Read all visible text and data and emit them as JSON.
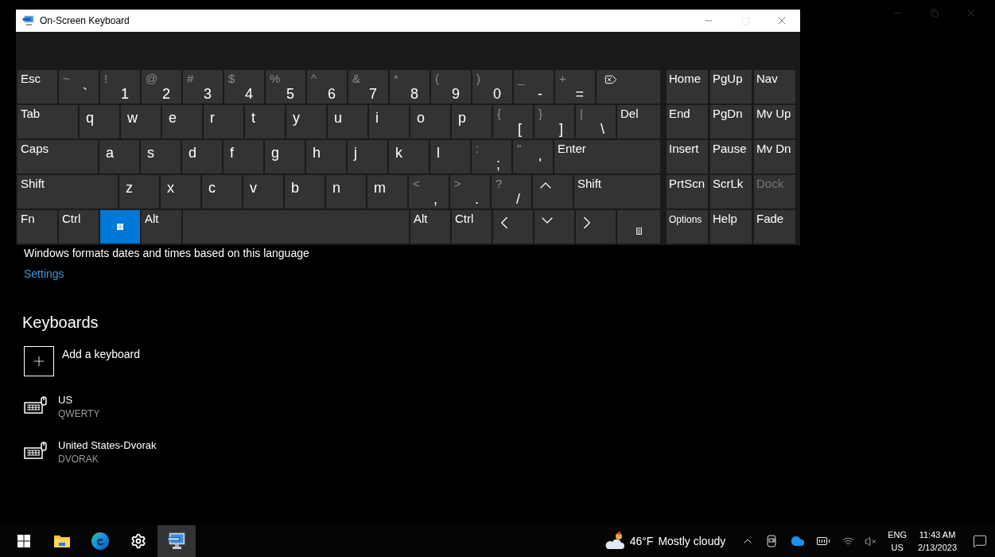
{
  "osk": {
    "title": "On-Screen Keyboard",
    "title_buttons": [
      {
        "kind": "minimize",
        "disabled": false
      },
      {
        "kind": "maximize",
        "disabled": true
      },
      {
        "kind": "close",
        "disabled": false
      }
    ],
    "keyboard_rows": [
      {
        "keys": [
          {
            "kind": "text",
            "label": "Esc",
            "pressed": false
          },
          {
            "kind": "dual",
            "shift": "~",
            "label": "`",
            "pressed": false
          },
          {
            "kind": "dual",
            "shift": "!",
            "label": "1",
            "pressed": false
          },
          {
            "kind": "dual",
            "shift": "@",
            "label": "2",
            "pressed": false
          },
          {
            "kind": "dual",
            "shift": "#",
            "label": "3",
            "pressed": false
          },
          {
            "kind": "dual",
            "shift": "$",
            "label": "4",
            "pressed": false
          },
          {
            "kind": "dual",
            "shift": "%",
            "label": "5",
            "pressed": false
          },
          {
            "kind": "dual",
            "shift": "^",
            "label": "6",
            "pressed": false
          },
          {
            "kind": "dual",
            "shift": "&",
            "label": "7",
            "pressed": false
          },
          {
            "kind": "dual",
            "shift": "*",
            "label": "8",
            "pressed": false
          },
          {
            "kind": "dual",
            "shift": "(",
            "label": "9",
            "pressed": false
          },
          {
            "kind": "dual",
            "shift": ")",
            "label": "0",
            "pressed": false
          },
          {
            "kind": "dual",
            "shift": "_",
            "label": "-",
            "pressed": false
          },
          {
            "kind": "dual",
            "shift": "+",
            "label": "=",
            "pressed": false
          },
          {
            "kind": "backspace",
            "pressed": false
          }
        ]
      },
      {
        "keys": [
          {
            "kind": "text",
            "label": "Tab",
            "pressed": false
          },
          {
            "kind": "letter",
            "label": "q",
            "pressed": false
          },
          {
            "kind": "letter",
            "label": "w",
            "pressed": false
          },
          {
            "kind": "letter",
            "label": "e",
            "pressed": false
          },
          {
            "kind": "letter",
            "label": "r",
            "pressed": false
          },
          {
            "kind": "letter",
            "label": "t",
            "pressed": false
          },
          {
            "kind": "letter",
            "label": "y",
            "pressed": false
          },
          {
            "kind": "letter",
            "label": "u",
            "pressed": false
          },
          {
            "kind": "letter",
            "label": "i",
            "pressed": false
          },
          {
            "kind": "letter",
            "label": "o",
            "pressed": false
          },
          {
            "kind": "letter",
            "label": "p",
            "pressed": false
          },
          {
            "kind": "dual",
            "shift": "{",
            "label": "[",
            "pressed": false
          },
          {
            "kind": "dual",
            "shift": "}",
            "label": "]",
            "pressed": false
          },
          {
            "kind": "dual",
            "shift": "|",
            "label": "\\",
            "pressed": false
          },
          {
            "kind": "text",
            "label": "Del",
            "pressed": false
          }
        ]
      },
      {
        "keys": [
          {
            "kind": "text",
            "label": "Caps",
            "pressed": false
          },
          {
            "kind": "letter",
            "label": "a",
            "pressed": false
          },
          {
            "kind": "letter",
            "label": "s",
            "pressed": false
          },
          {
            "kind": "letter",
            "label": "d",
            "pressed": false
          },
          {
            "kind": "letter",
            "label": "f",
            "pressed": false
          },
          {
            "kind": "letter",
            "label": "g",
            "pressed": false
          },
          {
            "kind": "letter",
            "label": "h",
            "pressed": false
          },
          {
            "kind": "letter",
            "label": "j",
            "pressed": false
          },
          {
            "kind": "letter",
            "label": "k",
            "pressed": false
          },
          {
            "kind": "letter",
            "label": "l",
            "pressed": false
          },
          {
            "kind": "dual",
            "shift": ":",
            "label": ";",
            "pressed": false
          },
          {
            "kind": "dual",
            "shift": "\"",
            "label": "'",
            "pressed": false
          },
          {
            "kind": "text",
            "label": "Enter",
            "pressed": false
          }
        ]
      },
      {
        "keys": [
          {
            "kind": "text",
            "label": "Shift",
            "pressed": false
          },
          {
            "kind": "letter",
            "label": "z",
            "pressed": false
          },
          {
            "kind": "letter",
            "label": "x",
            "pressed": false
          },
          {
            "kind": "letter",
            "label": "c",
            "pressed": false
          },
          {
            "kind": "letter",
            "label": "v",
            "pressed": false
          },
          {
            "kind": "letter",
            "label": "b",
            "pressed": false
          },
          {
            "kind": "letter",
            "label": "n",
            "pressed": false
          },
          {
            "kind": "letter",
            "label": "m",
            "pressed": false
          },
          {
            "kind": "dual",
            "shift": "<",
            "label": ",",
            "pressed": false
          },
          {
            "kind": "dual",
            "shift": ">",
            "label": ".",
            "pressed": false
          },
          {
            "kind": "dual",
            "shift": "?",
            "label": "/",
            "pressed": false
          },
          {
            "kind": "up",
            "pressed": false
          },
          {
            "kind": "text",
            "label": "Shift",
            "pressed": false
          }
        ]
      },
      {
        "keys": [
          {
            "kind": "text",
            "label": "Fn",
            "pressed": false
          },
          {
            "kind": "text",
            "label": "Ctrl",
            "pressed": false
          },
          {
            "kind": "win",
            "pressed": true
          },
          {
            "kind": "text",
            "label": "Alt",
            "pressed": false
          },
          {
            "kind": "space",
            "pressed": false
          },
          {
            "kind": "text",
            "label": "Alt",
            "pressed": false
          },
          {
            "kind": "text",
            "label": "Ctrl",
            "pressed": false
          },
          {
            "kind": "left",
            "pressed": false
          },
          {
            "kind": "down",
            "pressed": false
          },
          {
            "kind": "right",
            "pressed": false
          },
          {
            "kind": "menu",
            "pressed": false
          }
        ]
      }
    ],
    "nav_rows": [
      {
        "keys": [
          {
            "kind": "text",
            "label": "Home",
            "disabled": false
          },
          {
            "kind": "text",
            "label": "PgUp",
            "disabled": false
          },
          {
            "kind": "text",
            "label": "Nav",
            "disabled": false
          }
        ]
      },
      {
        "keys": [
          {
            "kind": "text",
            "label": "End",
            "disabled": false
          },
          {
            "kind": "text",
            "label": "PgDn",
            "disabled": false
          },
          {
            "kind": "text",
            "label": "Mv Up",
            "disabled": false
          }
        ]
      },
      {
        "keys": [
          {
            "kind": "text",
            "label": "Insert",
            "disabled": false
          },
          {
            "kind": "text",
            "label": "Pause",
            "disabled": false
          },
          {
            "kind": "text",
            "label": "Mv Dn",
            "disabled": false
          }
        ]
      },
      {
        "keys": [
          {
            "kind": "text",
            "label": "PrtScn",
            "disabled": false
          },
          {
            "kind": "text",
            "label": "ScrLk",
            "disabled": false
          },
          {
            "kind": "text",
            "label": "Dock",
            "disabled": true
          }
        ]
      },
      {
        "keys": [
          {
            "kind": "small",
            "label": "Options",
            "disabled": false
          },
          {
            "kind": "text",
            "label": "Help",
            "disabled": false
          },
          {
            "kind": "text",
            "label": "Fade",
            "disabled": false
          }
        ]
      }
    ]
  },
  "settings": {
    "description": "Windows formats dates and times based on this language",
    "settings_link": "Settings",
    "keyboards_heading": "Keyboards",
    "add_keyboard": "Add a keyboard",
    "keyboards": [
      {
        "name": "US",
        "layout": "QWERTY"
      },
      {
        "name": "United States-Dvorak",
        "layout": "DVORAK"
      }
    ]
  },
  "taskbar": {
    "apps": [
      {
        "kind": "start",
        "selected": false
      },
      {
        "kind": "explorer",
        "selected": false
      },
      {
        "kind": "edge",
        "selected": false
      },
      {
        "kind": "settings",
        "selected": false
      },
      {
        "kind": "osk",
        "selected": true
      }
    ],
    "weather": {
      "temperature": "46°F",
      "condition": "Mostly cloudy"
    },
    "language": "ENG",
    "region": "US",
    "time": "11:43 AM",
    "date": "2/13/2023"
  }
}
